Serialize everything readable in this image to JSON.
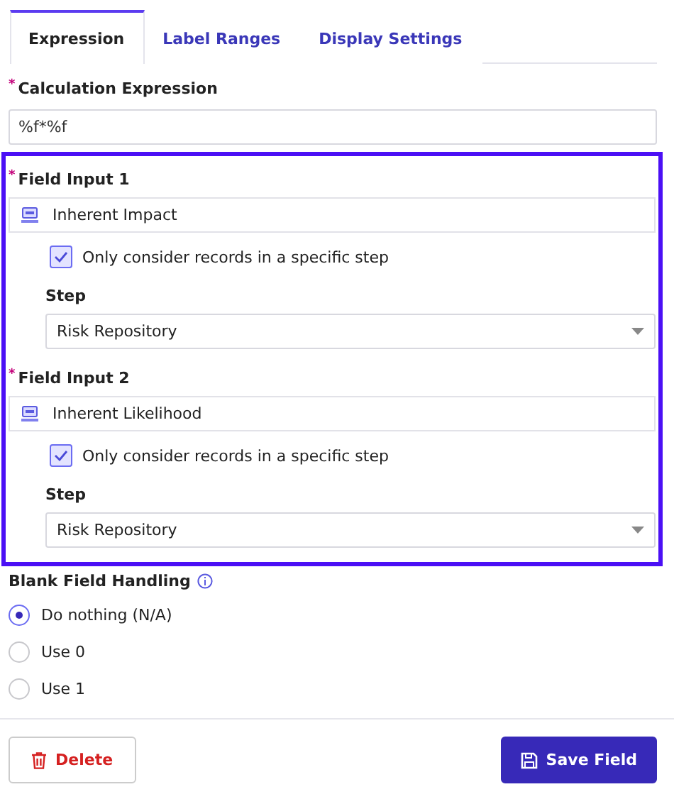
{
  "tabs": [
    {
      "label": "Expression",
      "selected": true
    },
    {
      "label": "Label Ranges",
      "selected": false
    },
    {
      "label": "Display Settings",
      "selected": false
    }
  ],
  "calculation": {
    "label": "Calculation Expression",
    "required_mark": "*",
    "value": "%f*%f"
  },
  "field_inputs": [
    {
      "label": "Field Input 1",
      "required_mark": "*",
      "field": "Inherent Impact",
      "step_filter": {
        "label": "Only consider records in a specific step",
        "checked": true
      },
      "step_label": "Step",
      "step_value": "Risk Repository"
    },
    {
      "label": "Field Input 2",
      "required_mark": "*",
      "field": "Inherent Likelihood",
      "step_filter": {
        "label": "Only consider records in a specific step",
        "checked": true
      },
      "step_label": "Step",
      "step_value": "Risk Repository"
    }
  ],
  "blank_handling": {
    "label": "Blank Field Handling",
    "options": [
      {
        "label": "Do nothing (N/A)",
        "selected": true
      },
      {
        "label": "Use 0",
        "selected": false
      },
      {
        "label": "Use 1",
        "selected": false
      }
    ]
  },
  "buttons": [
    {
      "kind": "danger",
      "label": "Delete"
    },
    {
      "kind": "primary",
      "label": "Save Field"
    }
  ]
}
